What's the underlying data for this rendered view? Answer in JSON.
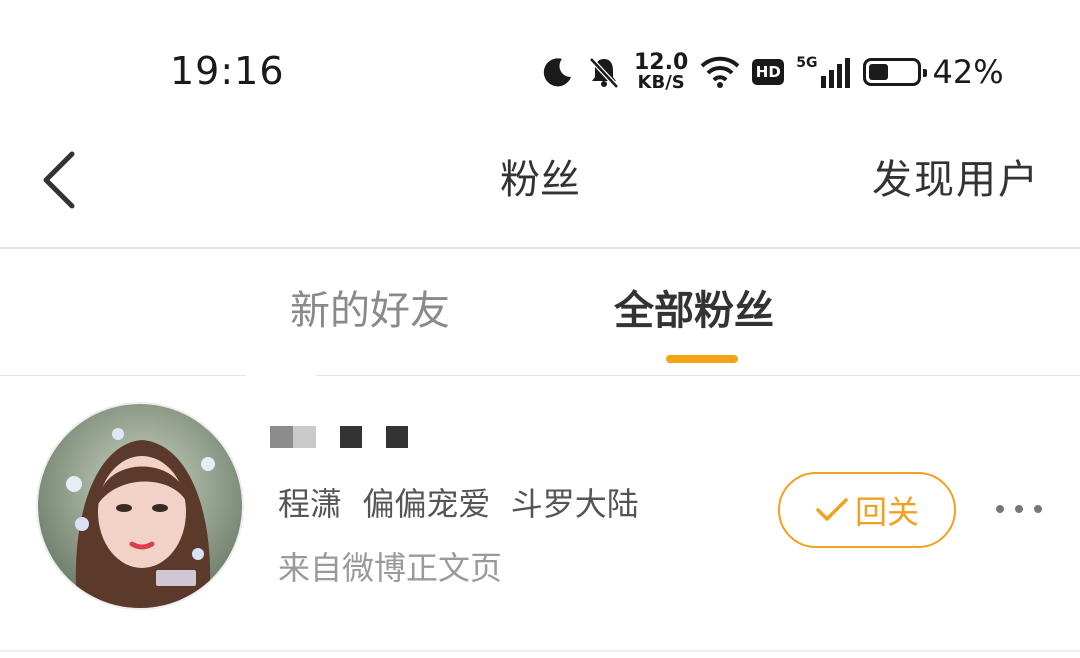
{
  "status_bar": {
    "time": "19:16",
    "net_speed_value": "12.0",
    "net_speed_unit": "KB/S",
    "hd_label": "HD",
    "network_label": "5G",
    "battery_percent_text": "42%",
    "battery_level": 0.42,
    "icons": [
      "moon-icon",
      "bell-muted-icon",
      "wifi-icon",
      "signal-icon",
      "battery-icon"
    ]
  },
  "nav": {
    "title": "粉丝",
    "right_action": "发现用户",
    "back_icon": "chevron-left-icon"
  },
  "tabs": [
    {
      "label": "新的好友",
      "active": false
    },
    {
      "label": "全部粉丝",
      "active": true
    }
  ],
  "colors": {
    "accent": "#f2a419",
    "text_primary": "#333333",
    "text_secondary": "#9a9a9a"
  },
  "fans": [
    {
      "signature": "程潇  偏偏宠爱  斗罗大陆",
      "source": "来自微博正文页",
      "follow_back_label": "回关",
      "more_icon": "more-horizontal-icon"
    }
  ]
}
